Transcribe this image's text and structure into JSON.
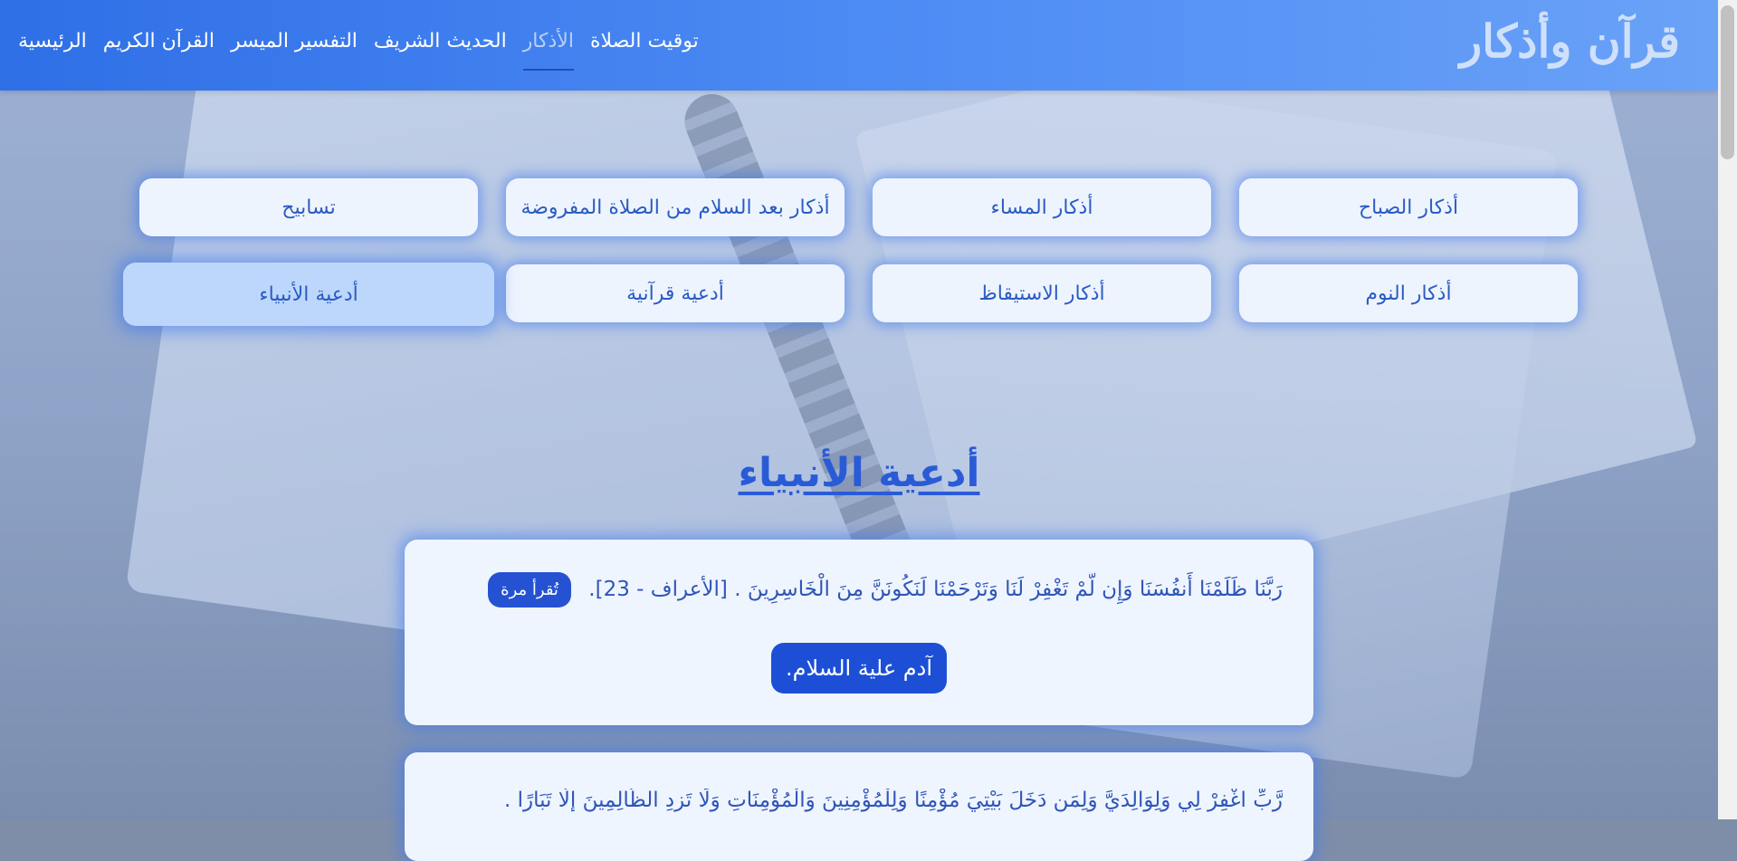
{
  "navbar": {
    "brand": "قرآن وأذكار",
    "links": [
      {
        "label": "الرئيسية"
      },
      {
        "label": "القرآن الكريم"
      },
      {
        "label": "التفسير الميسر"
      },
      {
        "label": "الحديث الشريف"
      },
      {
        "label": "الأذكار"
      },
      {
        "label": "توقيت الصلاة"
      }
    ],
    "active_link": "الأذكار"
  },
  "categories": [
    {
      "label": "أذكار الصباح"
    },
    {
      "label": "أذكار المساء"
    },
    {
      "label": "أذكار بعد السلام من الصلاة المفروضة"
    },
    {
      "label": "تسابيح"
    },
    {
      "label": "أذكار النوم"
    },
    {
      "label": "أذكار الاستيقاظ"
    },
    {
      "label": "أدعية قرآنية"
    },
    {
      "label": "أدعية الأنبياء"
    }
  ],
  "active_category": "أدعية الأنبياء",
  "section": {
    "title": "أدعية الأنبياء"
  },
  "cards": [
    {
      "text": "رَبَّنَا ظَلَمْنَا أَنفُسَنَا وَإِن لَّمْ تَغْفِرْ لَنَا وَتَرْحَمْنَا لَنَكُونَنَّ مِنَ الْخَاسِرِينَ . [الأعراف - 23].",
      "count": "تُقرأ مرة",
      "prophet": "آدم علية السلام."
    },
    {
      "text": "رَّبِّ اغْفِرْ لِي وَلِوَالِدَيَّ وَلِمَن دَخَلَ بَيْتِيَ مُؤْمِنًا وَلِلْمُؤْمِنِينَ وَالْمُؤْمِنَاتِ وَلَا تَزِدِ الظَّالِمِينَ إِلَّا تَبَارًا ."
    }
  ],
  "colors": {
    "navbar_start": "#2f6fe6",
    "navbar_end": "#6aa2f7",
    "accent": "#2552d3",
    "card_bg": "#eff5fe",
    "active_category_bg": "#bcd7fb"
  }
}
